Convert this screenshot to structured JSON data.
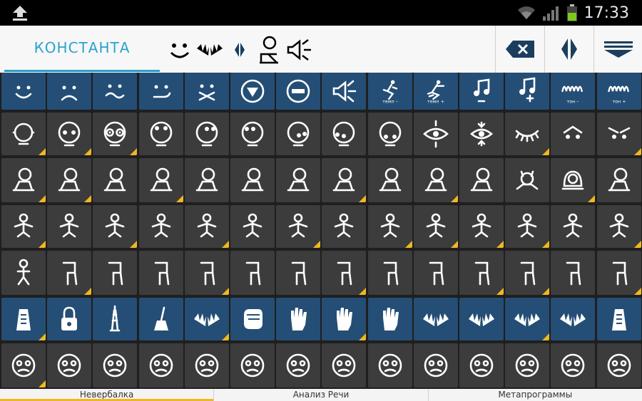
{
  "status": {
    "time": "17:33"
  },
  "toolbar": {
    "tab_label": "КОНСТАНТА",
    "symbols": [
      "smile-face-icon",
      "hands-icon",
      "diamond-split-icon",
      "person-thinking-icon",
      "speaker-icon"
    ],
    "buttons": [
      "backspace-icon",
      "split-icon",
      "keyboard-hide-icon"
    ]
  },
  "rows": [
    {
      "color": "blue",
      "cells": [
        {
          "icon": "smile-face-icon",
          "glyph": "smile"
        },
        {
          "icon": "sad-face-icon",
          "glyph": "sad"
        },
        {
          "icon": "wavy-smile-icon",
          "glyph": "wavy"
        },
        {
          "icon": "smirk-face-icon",
          "glyph": "smirk"
        },
        {
          "icon": "crossed-mouth-icon",
          "glyph": "cross"
        },
        {
          "icon": "down-arrow-circle-icon",
          "glyph": "downcircle"
        },
        {
          "icon": "minus-circle-icon",
          "glyph": "minuscircle"
        },
        {
          "icon": "megaphone-icon",
          "glyph": "mega"
        },
        {
          "icon": "tempo-minus-icon",
          "glyph": "tempominus",
          "caption": "темп –"
        },
        {
          "icon": "tempo-plus-icon",
          "glyph": "tempoplus",
          "caption": "темп +"
        },
        {
          "icon": "note-minus-icon",
          "glyph": "noteminus"
        },
        {
          "icon": "note-plus-icon",
          "glyph": "noteplus"
        },
        {
          "icon": "tone-minus-icon",
          "glyph": "toneminus",
          "caption": "тон –"
        },
        {
          "icon": "tone-plus-icon",
          "glyph": "toneplus",
          "caption": "тон +"
        }
      ]
    },
    {
      "color": "gray",
      "cells": [
        {
          "icon": "head-circle-icon",
          "glyph": "headsides",
          "corner": true
        },
        {
          "icon": "eyes-head-icon",
          "glyph": "eyes",
          "corner": true
        },
        {
          "icon": "goggle-eyes-icon",
          "glyph": "goggle",
          "corner": true
        },
        {
          "icon": "eyes-up-icon",
          "glyph": "eyesup"
        },
        {
          "icon": "eyes-right-icon",
          "glyph": "eyesright"
        },
        {
          "icon": "eyes-left-icon",
          "glyph": "eyesleft"
        },
        {
          "icon": "eyes-down-right-icon",
          "glyph": "eyesdr"
        },
        {
          "icon": "eyes-down-left-icon",
          "glyph": "eyesdl"
        },
        {
          "icon": "eyes-down-icon",
          "glyph": "eyesdown"
        },
        {
          "icon": "eye-expand-icon",
          "glyph": "eyeexp"
        },
        {
          "icon": "eye-focus-icon",
          "glyph": "eyefocus"
        },
        {
          "icon": "closed-eye-icon",
          "glyph": "closedeye",
          "corner": true
        },
        {
          "icon": "raised-brows-icon",
          "glyph": "raised"
        },
        {
          "icon": "frown-brows-icon",
          "glyph": "frownbrow",
          "corner": true
        }
      ]
    },
    {
      "color": "gray",
      "cells": [
        {
          "icon": "head-tilt-icon",
          "glyph": "tilt",
          "corner": true
        },
        {
          "icon": "head-tilt-2-icon",
          "glyph": "tilt",
          "corner": true
        },
        {
          "icon": "head-tilt-3-icon",
          "glyph": "tilt"
        },
        {
          "icon": "head-lean-icon",
          "glyph": "tilt",
          "corner": true
        },
        {
          "icon": "head-lean-2-icon",
          "glyph": "tilt"
        },
        {
          "icon": "shoulder-person-icon",
          "glyph": "tilt"
        },
        {
          "icon": "shoulder-person-2-icon",
          "glyph": "tilt"
        },
        {
          "icon": "shoulder-person-3-icon",
          "glyph": "tilt",
          "corner": true
        },
        {
          "icon": "shoulder-person-4-icon",
          "glyph": "tilt"
        },
        {
          "icon": "head-loop-icon",
          "glyph": "tilt",
          "corner": true
        },
        {
          "icon": "head-side-icon",
          "glyph": "tilt"
        },
        {
          "icon": "horned-head-icon",
          "glyph": "horned"
        },
        {
          "icon": "hooded-head-icon",
          "glyph": "hooded",
          "corner": true
        },
        {
          "icon": "head-bow-icon",
          "glyph": "tilt"
        }
      ]
    },
    {
      "color": "gray",
      "cells": [
        {
          "icon": "arms-down-icon",
          "glyph": "body",
          "corner": true
        },
        {
          "icon": "arms-hips-icon",
          "glyph": "body"
        },
        {
          "icon": "arms-crossed-icon",
          "glyph": "body",
          "corner": true
        },
        {
          "icon": "arms-box-icon",
          "glyph": "body"
        },
        {
          "icon": "arms-round-icon",
          "glyph": "body",
          "corner": true
        },
        {
          "icon": "hand-chin-icon",
          "glyph": "body"
        },
        {
          "icon": "arms-wave-icon",
          "glyph": "body",
          "corner": true
        },
        {
          "icon": "arms-table-icon",
          "glyph": "body"
        },
        {
          "icon": "arms-bar-icon",
          "glyph": "body",
          "corner": true
        },
        {
          "icon": "arms-frame-icon",
          "glyph": "body",
          "corner": true
        },
        {
          "icon": "arm-cross-icon",
          "glyph": "body",
          "corner": true
        },
        {
          "icon": "torso-diamond-icon",
          "glyph": "body",
          "corner": true
        },
        {
          "icon": "torso-box-icon",
          "glyph": "body"
        },
        {
          "icon": "torso-side-icon",
          "glyph": "body",
          "corner": true
        }
      ]
    },
    {
      "color": "gray",
      "cells": [
        {
          "icon": "standing-person-icon",
          "glyph": "stand"
        },
        {
          "icon": "legs-sit-icon",
          "glyph": "legs",
          "corner": true
        },
        {
          "icon": "legs-zigzag-icon",
          "glyph": "legs"
        },
        {
          "icon": "legs-cross-icon",
          "glyph": "legs"
        },
        {
          "icon": "legs-sit-2-icon",
          "glyph": "legs",
          "corner": true
        },
        {
          "icon": "legs-bent-icon",
          "glyph": "legs"
        },
        {
          "icon": "legs-slash-icon",
          "glyph": "legs"
        },
        {
          "icon": "legs-slash-2-icon",
          "glyph": "legs",
          "corner": true
        },
        {
          "icon": "legs-n-icon",
          "glyph": "legs"
        },
        {
          "icon": "legs-open-icon",
          "glyph": "legs"
        },
        {
          "icon": "legs-wide-icon",
          "glyph": "legs",
          "corner": true
        },
        {
          "icon": "legs-p-icon",
          "glyph": "legs",
          "corner": true
        },
        {
          "icon": "legs-x-icon",
          "glyph": "legs"
        },
        {
          "icon": "legs-k-icon",
          "glyph": "legs",
          "corner": true
        }
      ]
    },
    {
      "color": "blue",
      "cells": [
        {
          "icon": "grater-icon",
          "glyph": "grater",
          "corner": true
        },
        {
          "icon": "padlock-icon",
          "glyph": "lock"
        },
        {
          "icon": "eiffel-tower-icon",
          "glyph": "tower"
        },
        {
          "icon": "broom-icon",
          "glyph": "broom"
        },
        {
          "icon": "spread-hands-icon",
          "glyph": "hands",
          "corner": true
        },
        {
          "icon": "fist-icon",
          "glyph": "fist"
        },
        {
          "icon": "open-hand-icon",
          "glyph": "hand"
        },
        {
          "icon": "hand-point-icon",
          "glyph": "hand",
          "corner": true
        },
        {
          "icon": "praying-hands-icon",
          "glyph": "hand"
        },
        {
          "icon": "handshake-icon",
          "glyph": "hands"
        },
        {
          "icon": "hands-cup-icon",
          "glyph": "hands"
        },
        {
          "icon": "hands-stack-icon",
          "glyph": "hands",
          "corner": true
        },
        {
          "icon": "hands-pass-icon",
          "glyph": "hands"
        },
        {
          "icon": "hand-grip-icon",
          "glyph": "grater"
        }
      ]
    },
    {
      "color": "gray",
      "cells": [
        {
          "icon": "angry-glasses-face-icon",
          "glyph": "face",
          "corner": true
        },
        {
          "icon": "suspicious-face-icon",
          "glyph": "face"
        },
        {
          "icon": "skeptical-face-icon",
          "glyph": "face"
        },
        {
          "icon": "worried-face-icon",
          "glyph": "face"
        },
        {
          "icon": "shocked-face-icon",
          "glyph": "face"
        },
        {
          "icon": "dizzy-face-icon",
          "glyph": "face"
        },
        {
          "icon": "grinning-face-icon",
          "glyph": "face"
        },
        {
          "icon": "troubled-face-icon",
          "glyph": "face"
        },
        {
          "icon": "surprised-face-icon",
          "glyph": "face"
        },
        {
          "icon": "happy-face-icon",
          "glyph": "face"
        },
        {
          "icon": "tired-face-icon",
          "glyph": "face"
        },
        {
          "icon": "angry-face-icon",
          "glyph": "face"
        },
        {
          "icon": "grimace-face-icon",
          "glyph": "face"
        },
        {
          "icon": "laughing-face-icon",
          "glyph": "face"
        }
      ]
    }
  ],
  "bottom_tabs": [
    {
      "label": "Невербалка",
      "active": true
    },
    {
      "label": "Анализ Речи",
      "active": false
    },
    {
      "label": "Метапрограммы",
      "active": false
    }
  ]
}
